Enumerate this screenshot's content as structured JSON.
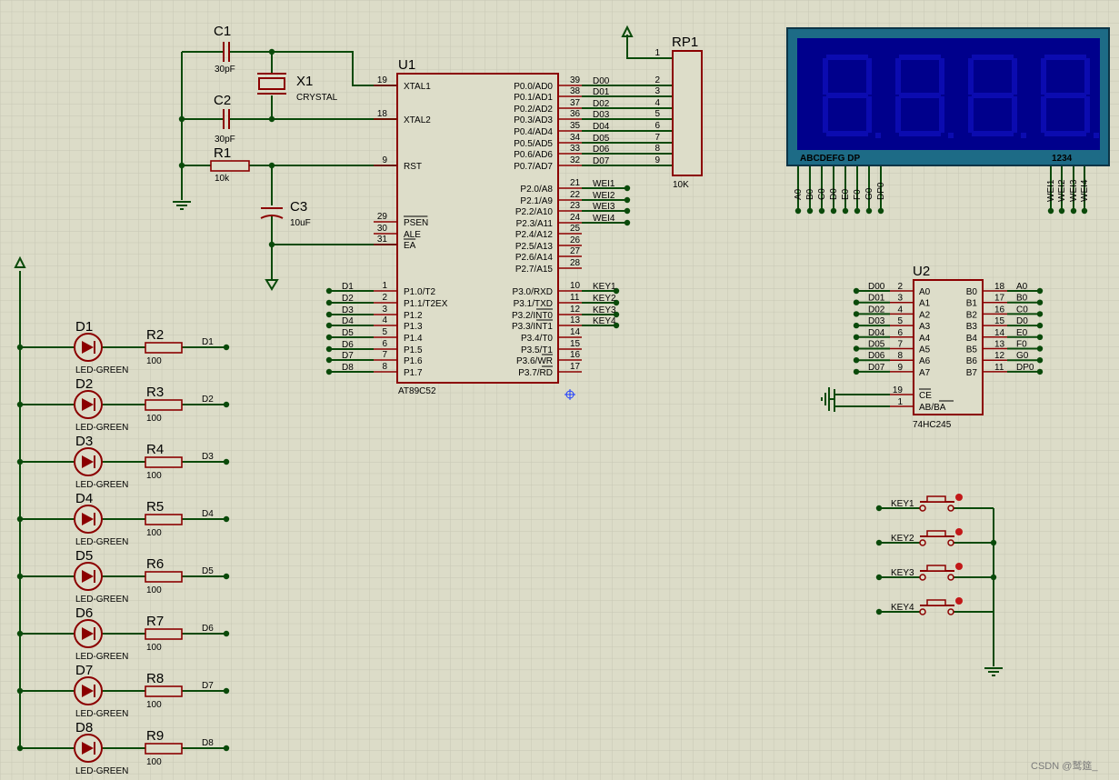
{
  "colors": {
    "background": "#dcdcc8",
    "grid": "#c6c6b4",
    "wire": "#0a4a0a",
    "component": "#8b0000",
    "body_fill": "#ddddc9",
    "lcd_frame": "#1d6b86",
    "lcd_face": "#00008c",
    "lcd_segment": "#0b0bb0"
  },
  "mcu": {
    "ref": "U1",
    "part": "AT89C52",
    "left_pins": [
      {
        "num": "19",
        "name": "XTAL1"
      },
      {
        "num": "18",
        "name": "XTAL2"
      },
      {
        "num": "9",
        "name": "RST"
      },
      {
        "num": "29",
        "name": "PSEN"
      },
      {
        "num": "30",
        "name": "ALE"
      },
      {
        "num": "31",
        "name": "EA"
      },
      {
        "num": "1",
        "name": "P1.0/T2"
      },
      {
        "num": "2",
        "name": "P1.1/T2EX"
      },
      {
        "num": "3",
        "name": "P1.2"
      },
      {
        "num": "4",
        "name": "P1.3"
      },
      {
        "num": "5",
        "name": "P1.4"
      },
      {
        "num": "6",
        "name": "P1.5"
      },
      {
        "num": "7",
        "name": "P1.6"
      },
      {
        "num": "8",
        "name": "P1.7"
      }
    ],
    "right_pins": [
      {
        "num": "39",
        "name": "P0.0/AD0",
        "net": "D00"
      },
      {
        "num": "38",
        "name": "P0.1/AD1",
        "net": "D01"
      },
      {
        "num": "37",
        "name": "P0.2/AD2",
        "net": "D02"
      },
      {
        "num": "36",
        "name": "P0.3/AD3",
        "net": "D03"
      },
      {
        "num": "35",
        "name": "P0.4/AD4",
        "net": "D04"
      },
      {
        "num": "34",
        "name": "P0.5/AD5",
        "net": "D05"
      },
      {
        "num": "33",
        "name": "P0.6/AD6",
        "net": "D06"
      },
      {
        "num": "32",
        "name": "P0.7/AD7",
        "net": "D07"
      },
      {
        "num": "21",
        "name": "P2.0/A8",
        "net": "WEI1"
      },
      {
        "num": "22",
        "name": "P2.1/A9",
        "net": "WEI2"
      },
      {
        "num": "23",
        "name": "P2.2/A10",
        "net": "WEI3"
      },
      {
        "num": "24",
        "name": "P2.3/A11",
        "net": "WEI4"
      },
      {
        "num": "25",
        "name": "P2.4/A12",
        "net": ""
      },
      {
        "num": "26",
        "name": "P2.5/A13",
        "net": ""
      },
      {
        "num": "27",
        "name": "P2.6/A14",
        "net": ""
      },
      {
        "num": "28",
        "name": "P2.7/A15",
        "net": ""
      },
      {
        "num": "10",
        "name": "P3.0/RXD",
        "net": "KEY1"
      },
      {
        "num": "11",
        "name": "P3.1/TXD",
        "net": "KEY2"
      },
      {
        "num": "12",
        "name": "P3.2/INT0",
        "net": "KEY3"
      },
      {
        "num": "13",
        "name": "P3.3/INT1",
        "net": "KEY4"
      },
      {
        "num": "14",
        "name": "P3.4/T0",
        "net": ""
      },
      {
        "num": "15",
        "name": "P3.5/T1",
        "net": ""
      },
      {
        "num": "16",
        "name": "P3.6/WR",
        "net": ""
      },
      {
        "num": "17",
        "name": "P3.7/RD",
        "net": ""
      }
    ],
    "p1_nets": [
      "D1",
      "D2",
      "D3",
      "D4",
      "D5",
      "D6",
      "D7",
      "D8"
    ]
  },
  "passives": {
    "c1": {
      "ref": "C1",
      "value": "30pF"
    },
    "c2": {
      "ref": "C2",
      "value": "30pF"
    },
    "c3": {
      "ref": "C3",
      "value": "10uF"
    },
    "x1": {
      "ref": "X1",
      "value": "CRYSTAL"
    },
    "r1": {
      "ref": "R1",
      "value": "10k"
    },
    "rp1": {
      "ref": "RP1",
      "value": "10K",
      "pins": [
        "1",
        "2",
        "3",
        "4",
        "5",
        "6",
        "7",
        "8",
        "9"
      ]
    }
  },
  "leds": [
    {
      "ref": "D1",
      "part": "LED-GREEN",
      "res": "R2",
      "res_val": "100",
      "net": "D1"
    },
    {
      "ref": "D2",
      "part": "LED-GREEN",
      "res": "R3",
      "res_val": "100",
      "net": "D2"
    },
    {
      "ref": "D3",
      "part": "LED-GREEN",
      "res": "R4",
      "res_val": "100",
      "net": "D3"
    },
    {
      "ref": "D4",
      "part": "LED-GREEN",
      "res": "R5",
      "res_val": "100",
      "net": "D4"
    },
    {
      "ref": "D5",
      "part": "LED-GREEN",
      "res": "R6",
      "res_val": "100",
      "net": "D5"
    },
    {
      "ref": "D6",
      "part": "LED-GREEN",
      "res": "R7",
      "res_val": "100",
      "net": "D6"
    },
    {
      "ref": "D7",
      "part": "LED-GREEN",
      "res": "R8",
      "res_val": "100",
      "net": "D7"
    },
    {
      "ref": "D8",
      "part": "LED-GREEN",
      "res": "R9",
      "res_val": "100",
      "net": "D8"
    }
  ],
  "buffer": {
    "ref": "U2",
    "part": "74HC245",
    "a_pins": [
      {
        "num": "2",
        "name": "A0",
        "net": "D00"
      },
      {
        "num": "3",
        "name": "A1",
        "net": "D01"
      },
      {
        "num": "4",
        "name": "A2",
        "net": "D02"
      },
      {
        "num": "5",
        "name": "A3",
        "net": "D03"
      },
      {
        "num": "6",
        "name": "A4",
        "net": "D04"
      },
      {
        "num": "7",
        "name": "A5",
        "net": "D05"
      },
      {
        "num": "8",
        "name": "A6",
        "net": "D06"
      },
      {
        "num": "9",
        "name": "A7",
        "net": "D07"
      }
    ],
    "b_pins": [
      {
        "num": "18",
        "name": "B0",
        "net": "A0"
      },
      {
        "num": "17",
        "name": "B1",
        "net": "B0"
      },
      {
        "num": "16",
        "name": "B2",
        "net": "C0"
      },
      {
        "num": "15",
        "name": "B3",
        "net": "D0"
      },
      {
        "num": "14",
        "name": "B4",
        "net": "E0"
      },
      {
        "num": "13",
        "name": "B5",
        "net": "F0"
      },
      {
        "num": "12",
        "name": "B6",
        "net": "G0"
      },
      {
        "num": "11",
        "name": "B7",
        "net": "DP0"
      }
    ],
    "ctrl_pins": [
      {
        "num": "19",
        "name": "CE"
      },
      {
        "num": "1",
        "name": "AB/BA"
      }
    ]
  },
  "display": {
    "segment_label": "ABCDEFG DP",
    "digit_label": "1234",
    "seg_nets": [
      "A0",
      "B0",
      "C0",
      "D0",
      "E0",
      "F0",
      "G0",
      "DP0"
    ],
    "digit_nets": [
      "WEI1",
      "WEI2",
      "WEI3",
      "WEI4"
    ]
  },
  "keys": [
    "KEY1",
    "KEY2",
    "KEY3",
    "KEY4"
  ],
  "watermark": "CSDN @鹫筵_"
}
